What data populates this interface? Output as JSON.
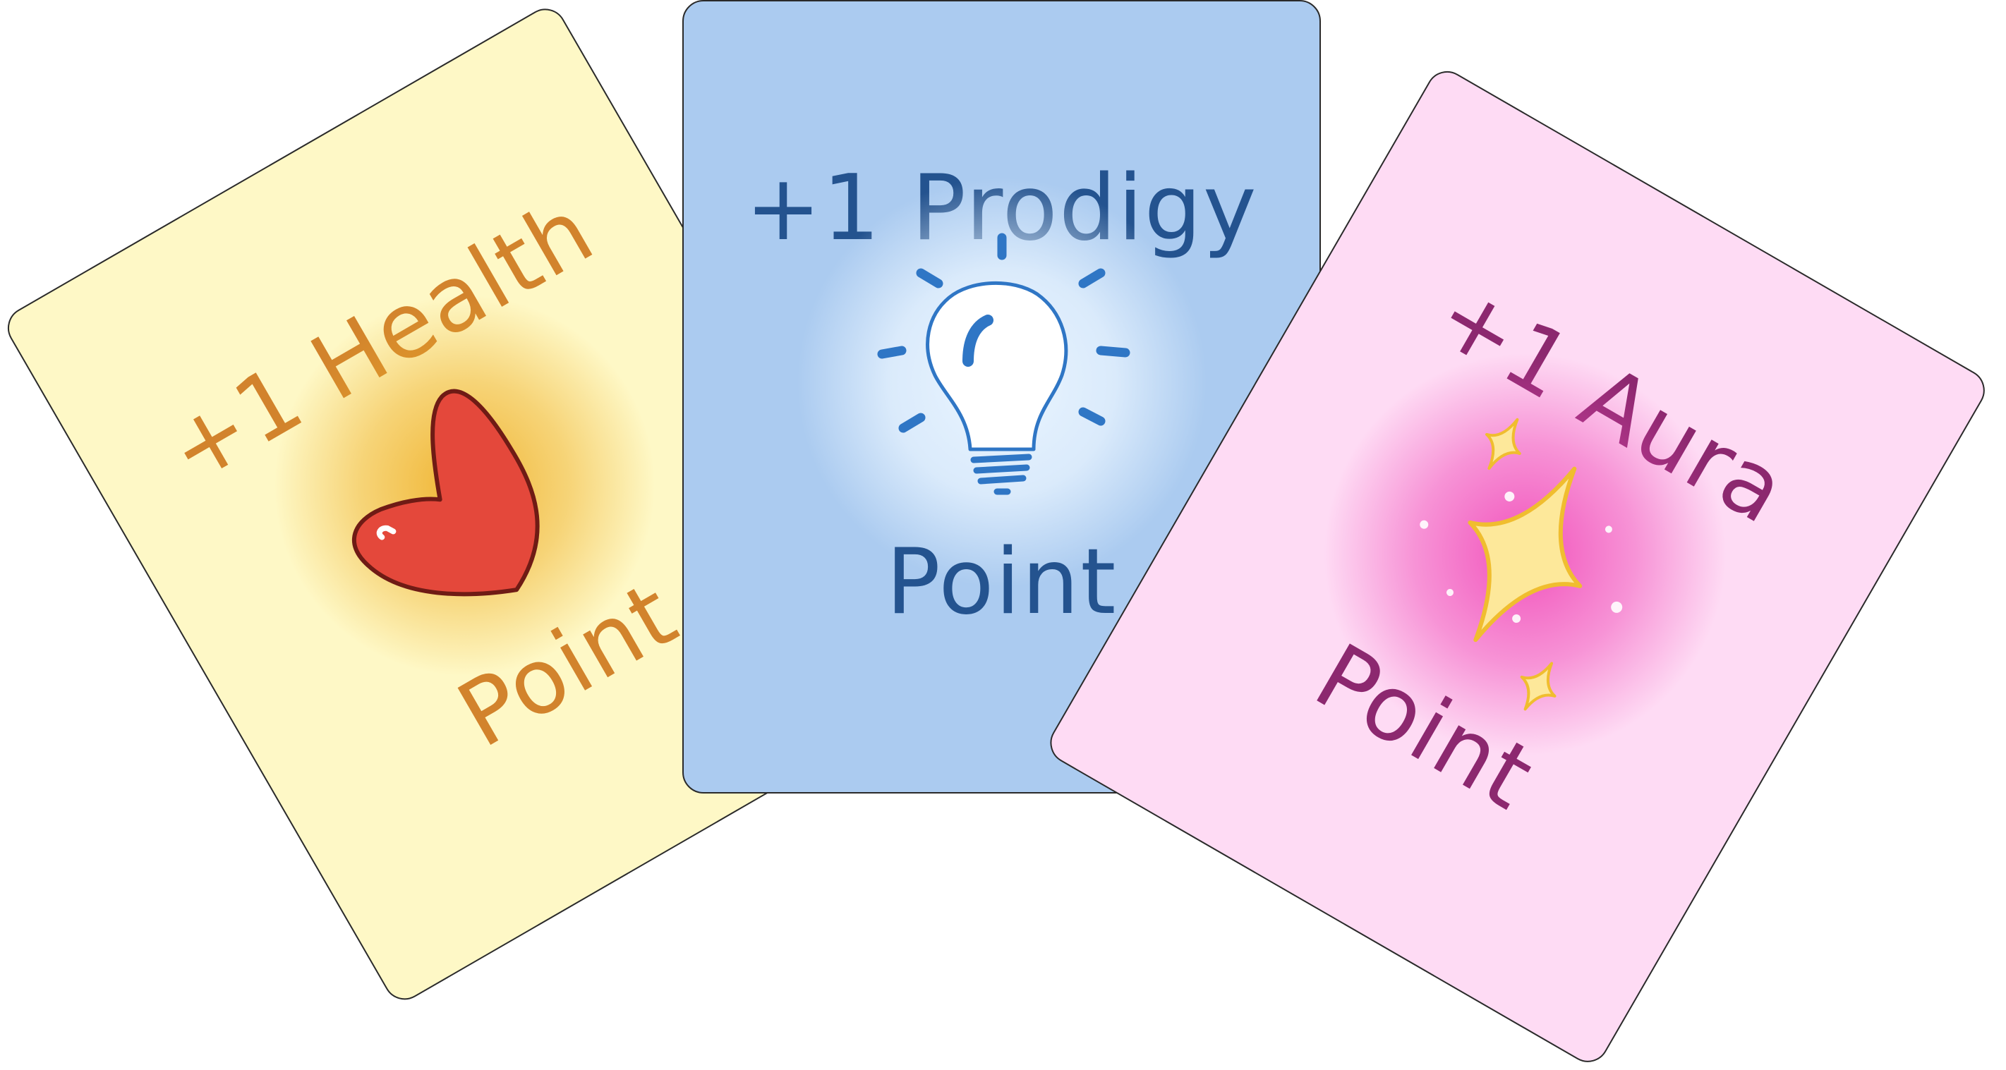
{
  "cards": [
    {
      "title": "+1 Health",
      "subtitle": "Point",
      "icon": "heart-icon",
      "background": "#fef8c6",
      "text_color": "#d2832c",
      "glow_color": "#efb029",
      "icon_color": "#e4483b",
      "outline_color": "#6f1b15"
    },
    {
      "title": "+1 Prodigy",
      "subtitle": "Point",
      "icon": "lightbulb-icon",
      "background": "#abcbf0",
      "text_color": "#24538f",
      "glow_color": "#eaf5ff",
      "icon_color": "#2f76c5",
      "outline_color": "#2f76c5"
    },
    {
      "title": "+1 Aura",
      "subtitle": "Point",
      "icon": "sparkle-icon",
      "background": "#fedbf4",
      "text_color": "#8c286f",
      "glow_color": "#f04bb8",
      "icon_color": "#fde89a",
      "outline_color": "#f0bd2f"
    }
  ]
}
